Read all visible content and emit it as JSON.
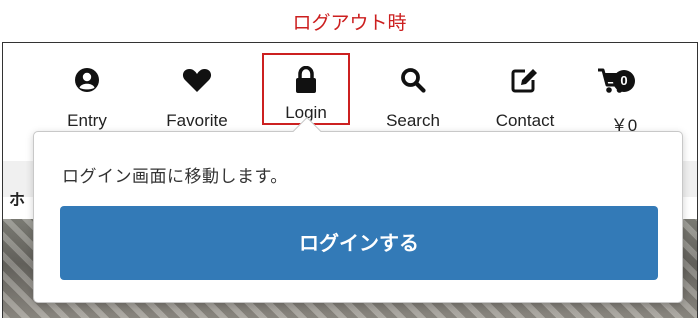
{
  "caption": "ログアウト時",
  "nav": {
    "entry": {
      "label": "Entry",
      "icon": "user-circle-icon"
    },
    "favorite": {
      "label": "Favorite",
      "icon": "heart-icon"
    },
    "login": {
      "label": "Login",
      "icon": "lock-icon"
    },
    "search": {
      "label": "Search",
      "icon": "search-icon"
    },
    "contact": {
      "label": "Contact",
      "icon": "edit-icon"
    },
    "cart": {
      "label": "￥0",
      "icon": "cart-icon",
      "count": "0"
    }
  },
  "page": {
    "heading": "ホ"
  },
  "popover": {
    "message": "ログイン画面に移動します。",
    "button_label": "ログインする"
  },
  "colors": {
    "caption": "#cc1f1f",
    "highlight_border": "#cc2020",
    "button_bg": "#337ab7"
  }
}
